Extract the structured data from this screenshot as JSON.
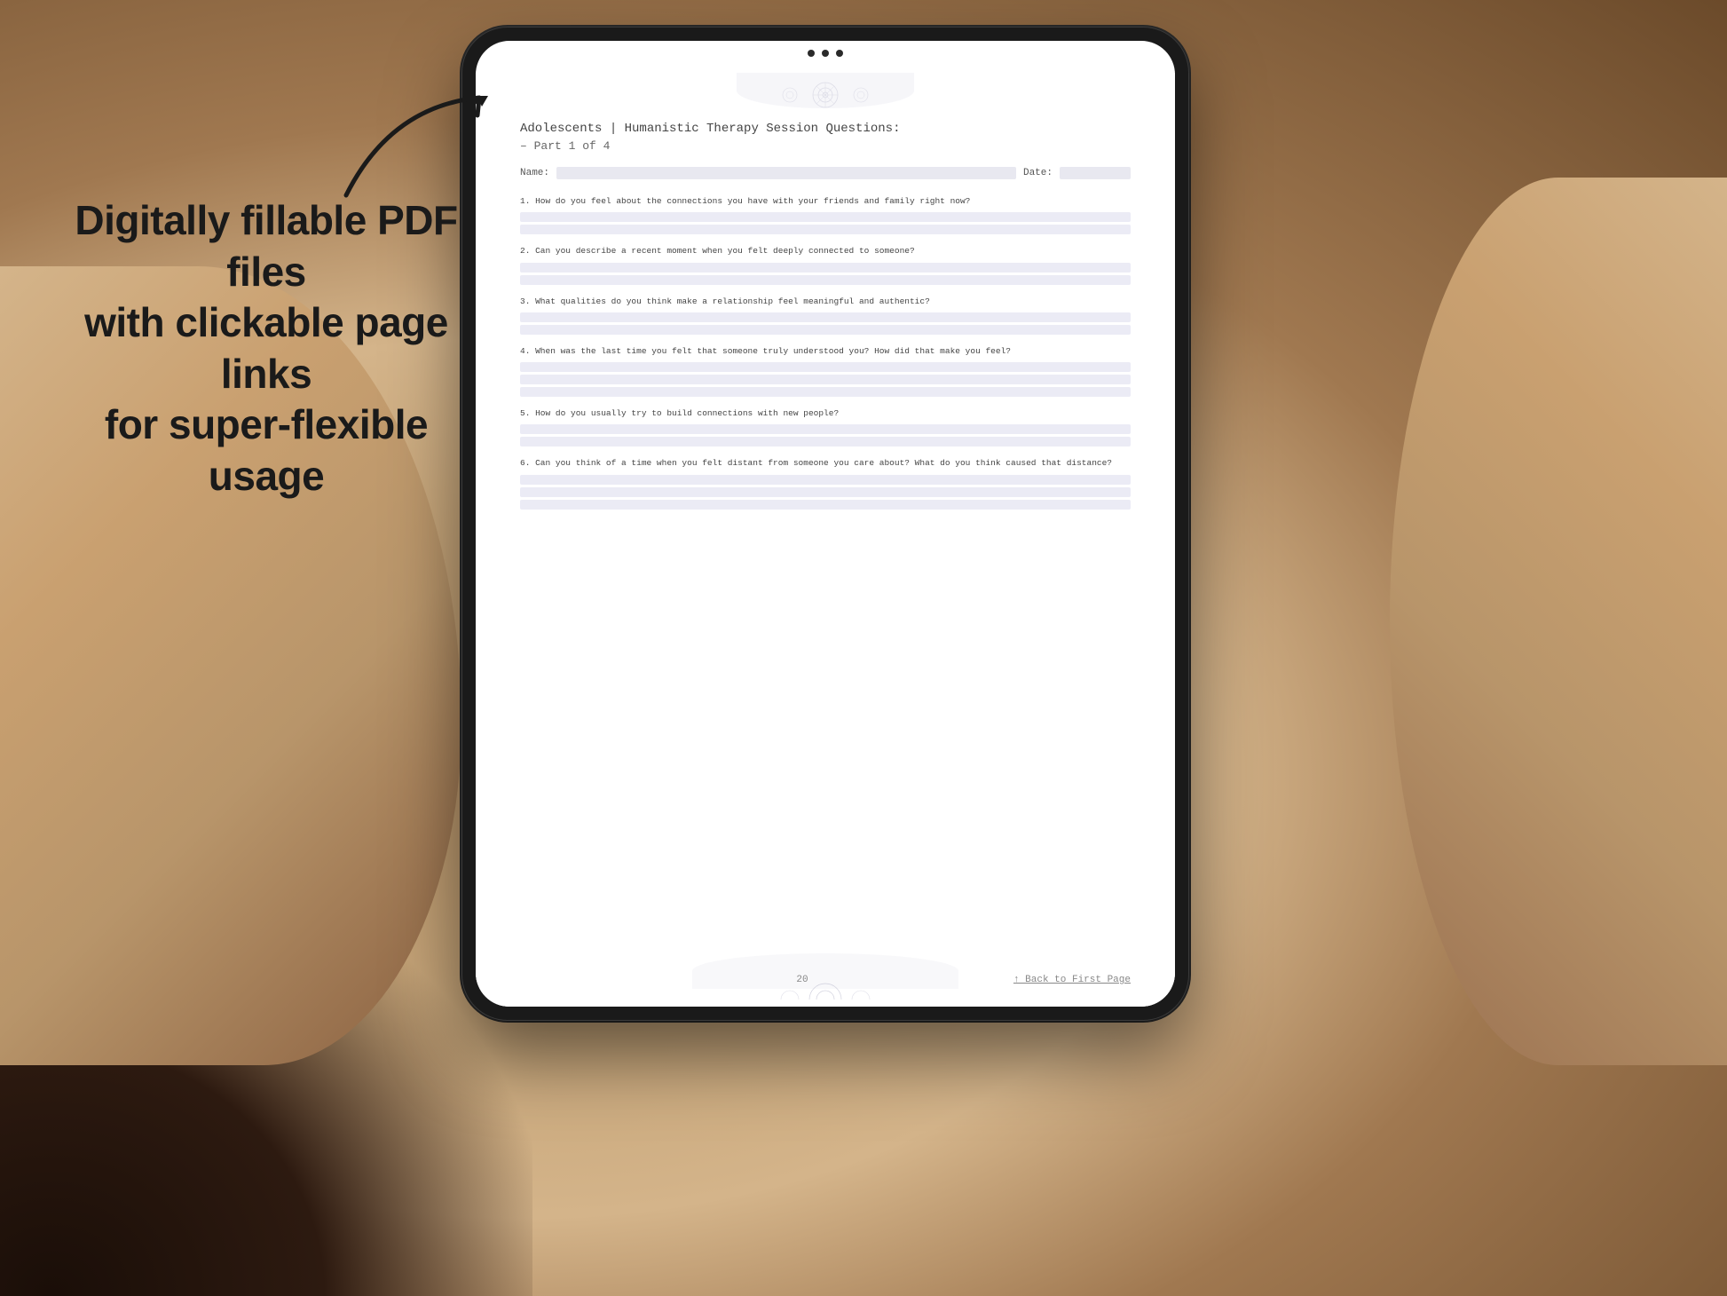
{
  "background": {
    "color": "#c4a882"
  },
  "marketing": {
    "main_text": "Digitally fillable PDF files\nwith clickable page links\nfor super-flexible usage",
    "arrow_label": "arrow"
  },
  "pdf": {
    "title": "Adolescents | Humanistic Therapy Session Questions:",
    "subtitle": "– Part 1 of 4",
    "name_label": "Name:",
    "date_label": "Date:",
    "questions": [
      {
        "number": "1",
        "text": "How do you feel about the connections you have with your friends and family right now?"
      },
      {
        "number": "2",
        "text": "Can you describe a recent moment when you felt deeply connected to someone?"
      },
      {
        "number": "3",
        "text": "What qualities do you think make a relationship feel meaningful and authentic?"
      },
      {
        "number": "4",
        "text": "When was the last time you felt that someone truly understood you? How did that make you feel?"
      },
      {
        "number": "5",
        "text": "How do you usually try to build connections with new people?"
      },
      {
        "number": "6",
        "text": "Can you think of a time when you felt distant from someone you care about? What do you think caused that distance?"
      }
    ],
    "footer": {
      "page_number": "20",
      "back_link": "↑ Back to First Page"
    }
  },
  "tablet": {
    "camera_dots": 3
  }
}
